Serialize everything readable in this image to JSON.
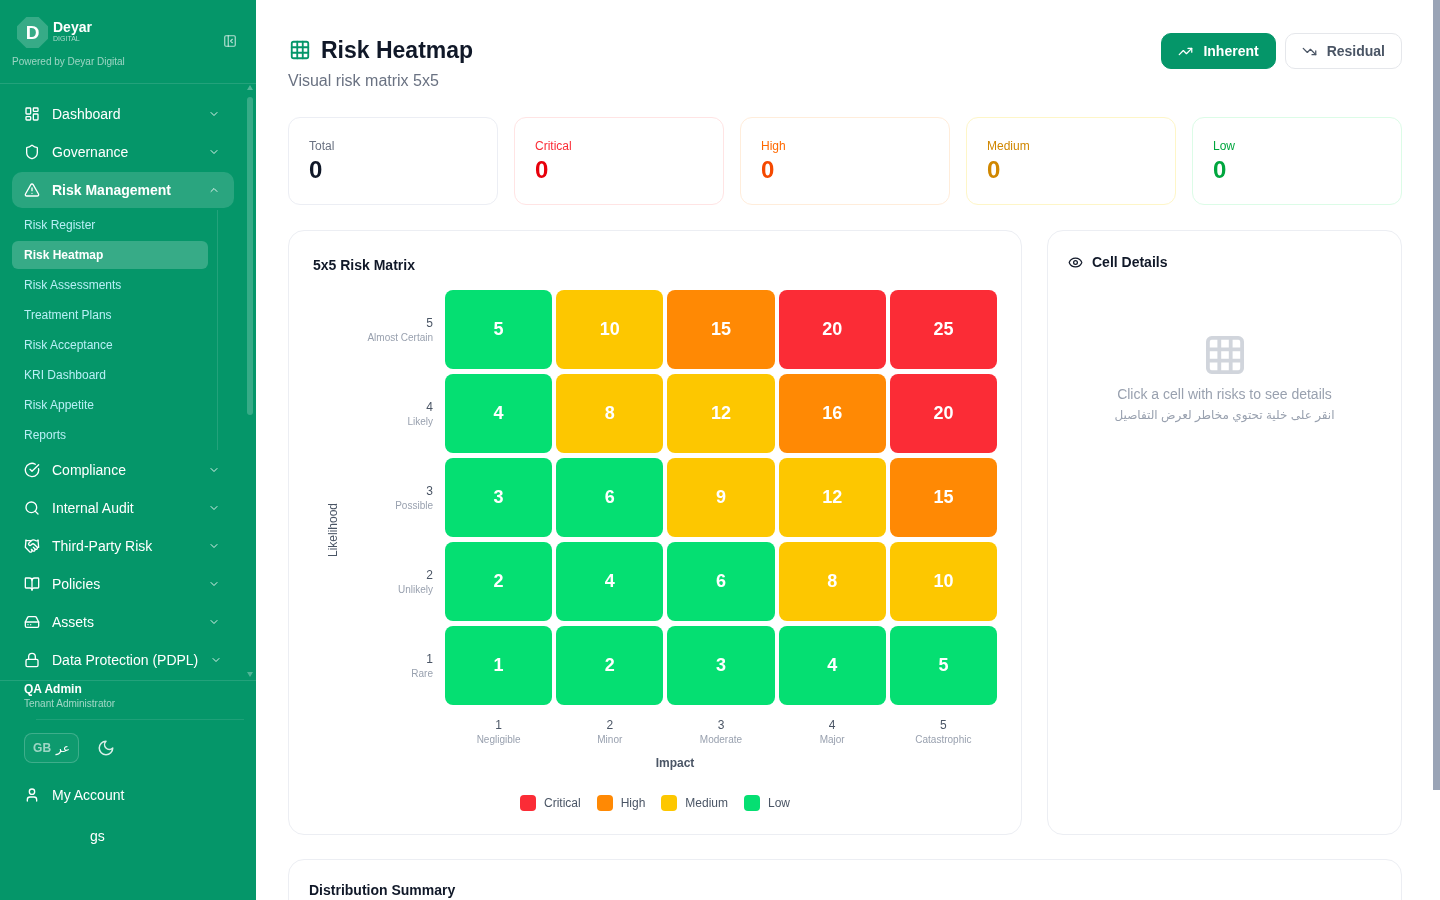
{
  "sidebar": {
    "brand": {
      "logo_letter": "D",
      "name": "Deyar",
      "tagline": "DIGITAL",
      "powered_by": "Powered by Deyar Digital"
    },
    "nav": [
      {
        "label": "Dashboard",
        "selected": false,
        "expanded": false
      },
      {
        "label": "Governance",
        "selected": false,
        "expanded": false
      },
      {
        "label": "Risk Management",
        "selected": true,
        "expanded": true,
        "children": [
          {
            "label": "Risk Register",
            "selected": false
          },
          {
            "label": "Risk Heatmap",
            "selected": true
          },
          {
            "label": "Risk Assessments",
            "selected": false
          },
          {
            "label": "Treatment Plans",
            "selected": false
          },
          {
            "label": "Risk Acceptance",
            "selected": false
          },
          {
            "label": "KRI Dashboard",
            "selected": false
          },
          {
            "label": "Risk Appetite",
            "selected": false
          },
          {
            "label": "Reports",
            "selected": false
          }
        ]
      },
      {
        "label": "Compliance",
        "selected": false,
        "expanded": false
      },
      {
        "label": "Internal Audit",
        "selected": false,
        "expanded": false
      },
      {
        "label": "Third-Party Risk",
        "selected": false,
        "expanded": false
      },
      {
        "label": "Policies",
        "selected": false,
        "expanded": false
      },
      {
        "label": "Assets",
        "selected": false,
        "expanded": false
      },
      {
        "label": "Data Protection (PDPL)",
        "selected": false,
        "expanded": false
      }
    ],
    "user": {
      "name": "QA Admin",
      "role": "Tenant Administrator"
    },
    "language_toggle": {
      "flag": "GB",
      "label": "عر"
    },
    "links": [
      {
        "label": "My Account"
      },
      {
        "label": "gs"
      }
    ]
  },
  "header": {
    "title": "Risk Heatmap",
    "subtitle": "Visual risk matrix 5x5",
    "views": [
      {
        "label": "Inherent",
        "kind": "inherent",
        "selected": true
      },
      {
        "label": "Residual",
        "kind": "residual",
        "selected": false
      }
    ]
  },
  "stats": [
    {
      "kind": "total",
      "label": "Total",
      "value": "0"
    },
    {
      "kind": "critical",
      "label": "Critical",
      "value": "0"
    },
    {
      "kind": "high",
      "label": "High",
      "value": "0"
    },
    {
      "kind": "medium",
      "label": "Medium",
      "value": "0"
    },
    {
      "kind": "low",
      "label": "Low",
      "value": "0"
    }
  ],
  "matrix": {
    "title": "5x5 Risk Matrix",
    "y_axis": "Likelihood",
    "rows": [
      {
        "value": "5",
        "label": "Almost Certain",
        "cells": [
          {
            "score": "5",
            "color": "#05df72"
          },
          {
            "score": "10",
            "color": "#fdc700"
          },
          {
            "score": "15",
            "color": "#ff8904"
          },
          {
            "score": "20",
            "color": "#fb2c36"
          },
          {
            "score": "25",
            "color": "#fb2c36"
          }
        ]
      },
      {
        "value": "4",
        "label": "Likely",
        "cells": [
          {
            "score": "4",
            "color": "#05df72"
          },
          {
            "score": "8",
            "color": "#fdc700"
          },
          {
            "score": "12",
            "color": "#fdc700"
          },
          {
            "score": "16",
            "color": "#ff8904"
          },
          {
            "score": "20",
            "color": "#fb2c36"
          }
        ]
      },
      {
        "value": "3",
        "label": "Possible",
        "cells": [
          {
            "score": "3",
            "color": "#05df72"
          },
          {
            "score": "6",
            "color": "#05df72"
          },
          {
            "score": "9",
            "color": "#fdc700"
          },
          {
            "score": "12",
            "color": "#fdc700"
          },
          {
            "score": "15",
            "color": "#ff8904"
          }
        ]
      },
      {
        "value": "2",
        "label": "Unlikely",
        "cells": [
          {
            "score": "2",
            "color": "#05df72"
          },
          {
            "score": "4",
            "color": "#05df72"
          },
          {
            "score": "6",
            "color": "#05df72"
          },
          {
            "score": "8",
            "color": "#fdc700"
          },
          {
            "score": "10",
            "color": "#fdc700"
          }
        ]
      },
      {
        "value": "1",
        "label": "Rare",
        "cells": [
          {
            "score": "1",
            "color": "#05df72"
          },
          {
            "score": "2",
            "color": "#05df72"
          },
          {
            "score": "3",
            "color": "#05df72"
          },
          {
            "score": "4",
            "color": "#05df72"
          },
          {
            "score": "5",
            "color": "#05df72"
          }
        ]
      }
    ],
    "impact_levels": [
      {
        "value": "1",
        "label": "Negligible"
      },
      {
        "value": "2",
        "label": "Minor"
      },
      {
        "value": "3",
        "label": "Moderate"
      },
      {
        "value": "4",
        "label": "Major"
      },
      {
        "value": "5",
        "label": "Catastrophic"
      }
    ],
    "x_axis": "Impact",
    "legend": [
      {
        "label": "Critical",
        "color": "#fb2c36"
      },
      {
        "label": "High",
        "color": "#ff8904"
      },
      {
        "label": "Medium",
        "color": "#fdc700"
      },
      {
        "label": "Low",
        "color": "#05df72"
      }
    ]
  },
  "cell_details": {
    "title": "Cell Details",
    "empty_message": "Click a cell with risks to see details",
    "empty_message_ar": "انقر على خلية تحتوي مخاطر لعرض التفاصيل"
  },
  "distribution": {
    "title": "Distribution Summary"
  }
}
